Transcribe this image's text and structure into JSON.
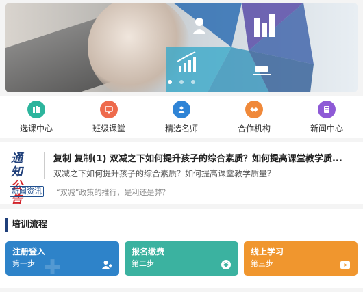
{
  "banner": {
    "dots": 3,
    "active_dot": 1
  },
  "nav": {
    "items": [
      {
        "label": "选课中心",
        "icon": "course-select-icon",
        "color": "#2db59d"
      },
      {
        "label": "班级课堂",
        "icon": "class-icon",
        "color": "#ee6a4c"
      },
      {
        "label": "精选名师",
        "icon": "teacher-icon",
        "color": "#2f84d6"
      },
      {
        "label": "合作机构",
        "icon": "handshake-icon",
        "color": "#f0893a"
      },
      {
        "label": "新闻中心",
        "icon": "news-icon",
        "color": "#8e5ad6"
      }
    ]
  },
  "notice": {
    "logo_line1": "通知",
    "logo_line2": "公告",
    "title": "复制 复制(1) 双减之下如何提升孩子的综合素质？如何提高课堂教学质...",
    "subtitle": "双减之下如何提升孩子的综合素质？如何提高课堂教学质量？",
    "tag": "新闻资讯",
    "news": "“双减”政策的推行，是利还是弊？"
  },
  "training": {
    "heading": "培训流程",
    "steps": [
      {
        "title": "注册登入",
        "step": "第一步",
        "icon": "user-add-icon",
        "color": "#2e83c9"
      },
      {
        "title": "报名缴费",
        "step": "第二步",
        "icon": "payment-icon",
        "color": "#3bb2a0"
      },
      {
        "title": "线上学习",
        "step": "第三步",
        "icon": "video-play-icon",
        "color": "#f0962e"
      }
    ]
  }
}
